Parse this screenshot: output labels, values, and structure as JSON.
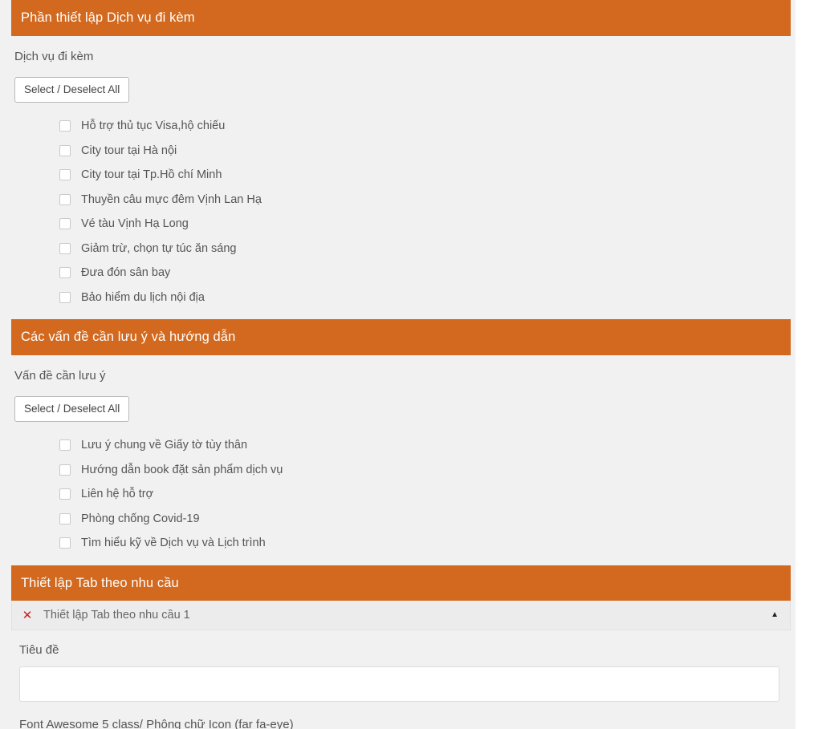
{
  "sections": [
    {
      "bar_title": "Phần thiết lập Dịch vụ đi kèm",
      "field_label": "Dịch vụ đi kèm",
      "toggle_all_label": "Select / Deselect All",
      "items": [
        "Hỗ trợ thủ tục Visa,hộ chiếu",
        "City tour tại Hà nội",
        "City tour tại Tp.Hồ chí Minh",
        "Thuyền câu mực đêm Vịnh Lan Hạ",
        "Vé tàu Vịnh Hạ Long",
        "Giảm trừ, chọn tự túc ăn sáng",
        "Đưa đón sân bay",
        "Bảo hiểm du lịch nội địa"
      ]
    },
    {
      "bar_title": "Các vấn đề cần lưu ý và hướng dẫn",
      "field_label": "Vấn đề cần lưu ý",
      "toggle_all_label": "Select / Deselect All",
      "items": [
        "Lưu ý chung về Giấy tờ tùy thân",
        "Hướng dẫn book đặt sản phẩm dịch vụ",
        "Liên hệ hỗ trợ",
        "Phòng chống Covid-19",
        "Tìm hiểu kỹ về Dịch vụ và Lịch trình"
      ]
    }
  ],
  "tab_section": {
    "bar_title": "Thiết lập Tab theo nhu cầu",
    "tab": {
      "remove_icon": "✕",
      "title": "Thiết lập Tab theo nhu cầu 1",
      "caret_icon": "▲",
      "title_field_label": "Tiêu đề",
      "title_field_value": "",
      "title_field_placeholder": "",
      "icon_field_label": "Font Awesome 5 class/ Phông chữ Icon (far fa-eye)"
    }
  },
  "colors": {
    "accent": "#d2691e",
    "canvas": "#f1f1f1",
    "tab_header": "#ececec",
    "remove": "#cc2222",
    "text": "#555555"
  }
}
